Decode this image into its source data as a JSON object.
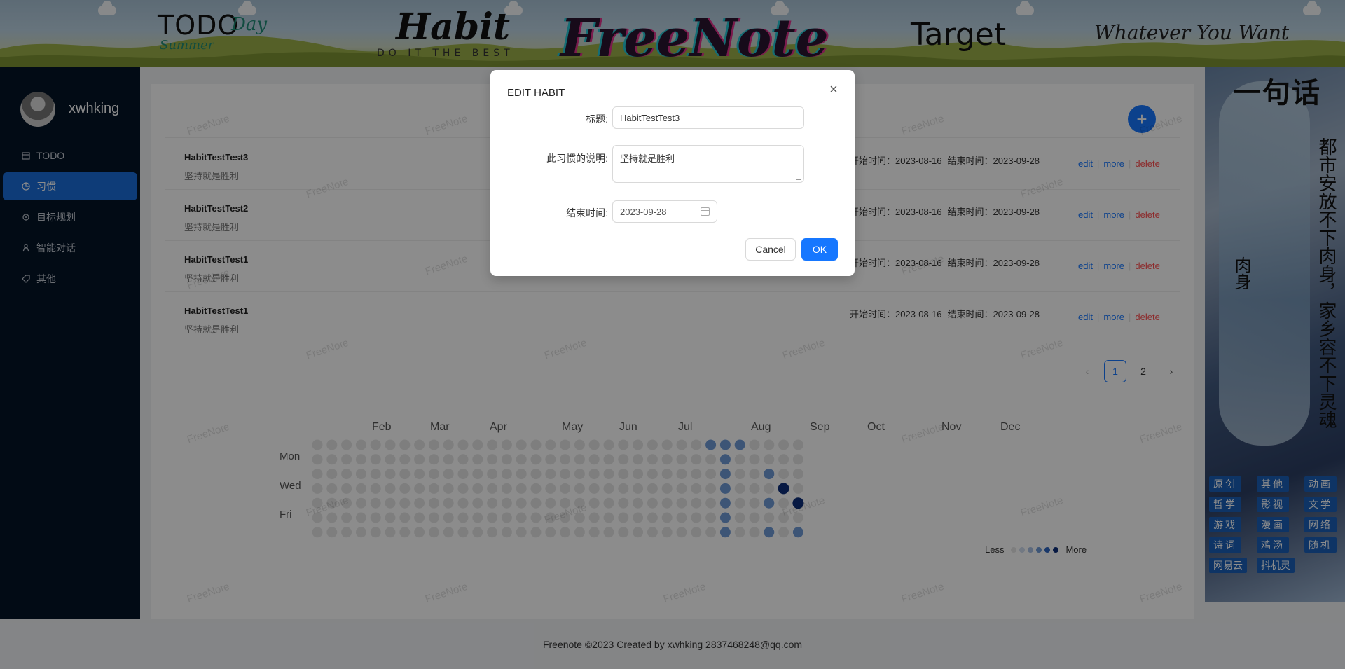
{
  "header": {
    "nav_todo": "TODO",
    "nav_todo_day": "Day",
    "nav_todo_summer": "Summer",
    "nav_habit": "Habit",
    "nav_habit_sub": "DO IT THE BEST",
    "nav_freenote": "FreeNote",
    "nav_target": "Target",
    "nav_whatever": "Whatever You Want"
  },
  "sidebar": {
    "username": "xwhking",
    "items": [
      {
        "label": "TODO",
        "icon": "calendar-icon"
      },
      {
        "label": "习惯",
        "icon": "pie-chart-icon",
        "active": true
      },
      {
        "label": "目标规划",
        "icon": "aim-icon"
      },
      {
        "label": "智能对话",
        "icon": "robot-icon"
      },
      {
        "label": "其他",
        "icon": "tag-icon"
      }
    ]
  },
  "habits": [
    {
      "title": "HabitTestTest3",
      "desc": "坚持就是胜利",
      "start": "开始时间：2023-08-16",
      "end": "结束时间：2023-09-28"
    },
    {
      "title": "HabitTestTest2",
      "desc": "坚持就是胜利",
      "start": "开始时间：2023-08-16",
      "end": "结束时间：2023-09-28"
    },
    {
      "title": "HabitTestTest1",
      "desc": "坚持就是胜利",
      "start": "开始时间：2023-08-16",
      "end": "结束时间：2023-09-28"
    },
    {
      "title": "HabitTestTest1",
      "desc": "坚持就是胜利",
      "start": "开始时间：2023-08-16",
      "end": "结束时间：2023-09-28"
    }
  ],
  "actions": {
    "edit": "edit",
    "more": "more",
    "delete": "delete"
  },
  "pagination": {
    "pages": [
      "1",
      "2"
    ],
    "current": "1"
  },
  "heatmap": {
    "months": [
      "Feb",
      "Mar",
      "Apr",
      "May",
      "Jun",
      "Jul",
      "Aug",
      "Sep",
      "Oct",
      "Nov",
      "Dec"
    ],
    "weekdays": [
      "Mon",
      "Wed",
      "Fri"
    ],
    "legend_less": "Less",
    "legend_more": "More",
    "colors": [
      "#e6e6e6",
      "#cfdcee",
      "#a9c2e6",
      "#6f9bd8",
      "#2f66c2",
      "#0d2f7a"
    ],
    "active_cells": [
      {
        "week": 27,
        "day": 0,
        "level": 3
      },
      {
        "week": 28,
        "day": 0,
        "level": 3
      },
      {
        "week": 29,
        "day": 0,
        "level": 3
      },
      {
        "week": 28,
        "day": 1,
        "level": 3
      },
      {
        "week": 28,
        "day": 2,
        "level": 3
      },
      {
        "week": 28,
        "day": 3,
        "level": 3
      },
      {
        "week": 28,
        "day": 4,
        "level": 3
      },
      {
        "week": 28,
        "day": 5,
        "level": 3
      },
      {
        "week": 28,
        "day": 6,
        "level": 3
      },
      {
        "week": 31,
        "day": 2,
        "level": 3
      },
      {
        "week": 31,
        "day": 4,
        "level": 3
      },
      {
        "week": 31,
        "day": 6,
        "level": 3
      },
      {
        "week": 32,
        "day": 3,
        "level": 5
      },
      {
        "week": 33,
        "day": 4,
        "level": 5
      },
      {
        "week": 33,
        "day": 6,
        "level": 3
      }
    ]
  },
  "watermark": "FreeNote",
  "right_panel": {
    "title": "一句话",
    "vertical_text": "都市安放不下肉身，家乡容不下灵魂",
    "vertical_text2": "肉身",
    "tags": [
      "原创",
      "其他",
      "动画",
      "哲学",
      "影视",
      "文学",
      "游戏",
      "漫画",
      "网络",
      "诗词",
      "鸡汤",
      "随机",
      "网易云",
      "抖机灵"
    ]
  },
  "footer": {
    "text": "Freenote ©2023 Created by xwhking 2837468248@qq.com"
  },
  "modal": {
    "title": "EDIT HABIT",
    "title_label": "标题:",
    "title_value": "HabitTestTest3",
    "desc_label": "此习惯的说明:",
    "desc_value": "坚持就是胜利",
    "end_label": "结束时间:",
    "end_value": "2023-09-28",
    "cancel": "Cancel",
    "ok": "OK"
  }
}
